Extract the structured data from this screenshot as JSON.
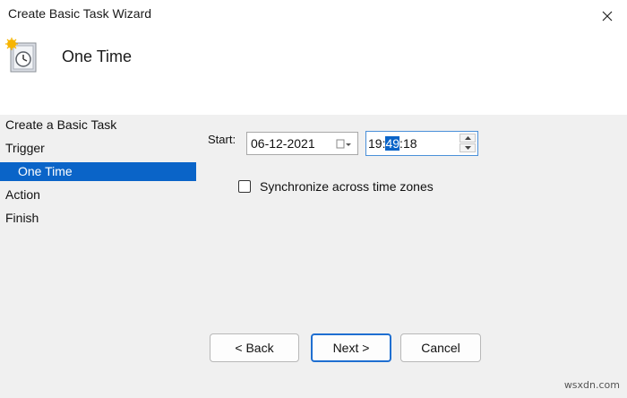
{
  "window": {
    "title": "Create Basic Task Wizard"
  },
  "header": {
    "title": "One Time"
  },
  "nav": {
    "items": [
      {
        "label": "Create a Basic Task"
      },
      {
        "label": "Trigger"
      },
      {
        "label": "One Time",
        "selected": true
      },
      {
        "label": "Action"
      },
      {
        "label": "Finish"
      }
    ]
  },
  "form": {
    "start_label": "Start:",
    "date_value": "06-12-2021",
    "time_hour": "19",
    "time_minute_selected": "49",
    "time_second": "18",
    "sync_label": "Synchronize across time zones",
    "sync_checked": false
  },
  "buttons": {
    "back": "< Back",
    "next": "Next >",
    "cancel": "Cancel"
  },
  "watermark": "wsxdn.com",
  "colors": {
    "selection": "#0a64c8",
    "primary_border": "#1f6fd1"
  }
}
